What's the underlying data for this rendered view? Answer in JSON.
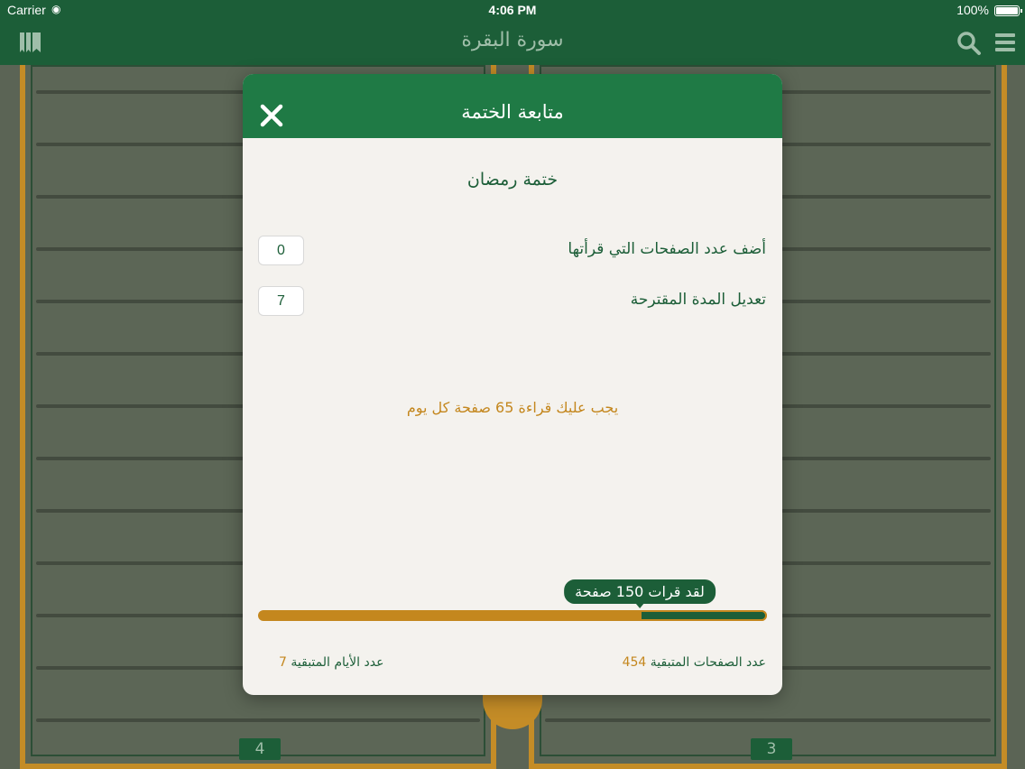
{
  "status_bar": {
    "carrier": "Carrier",
    "time": "4:06 PM",
    "battery": "100%"
  },
  "nav": {
    "title": "سورة البقرة"
  },
  "pages": {
    "left_number": "4",
    "right_number": "3"
  },
  "modal": {
    "title": "متابعة الختمة",
    "plan_name": "ختمة رمضان",
    "pages_read_label": "أضف عدد الصفحات التي قرأتها",
    "pages_read_value": "0",
    "duration_label": "تعديل المدة المقترحة",
    "duration_value": "7",
    "advice": "يجب عليك قراءة 65 صفحة كل يوم",
    "progress": {
      "read_tooltip": "لقد قرات 150 صفحة",
      "read_fraction": 0.25
    },
    "remaining_pages_label": "عدد الصفحات المتبقية",
    "remaining_pages_value": "454",
    "remaining_days_label": "عدد الأيام المتبقية",
    "remaining_days_value": "7"
  },
  "colors": {
    "primary_green": "#1f7a45",
    "dark_green": "#1c5e38",
    "gold": "#c4871e"
  }
}
